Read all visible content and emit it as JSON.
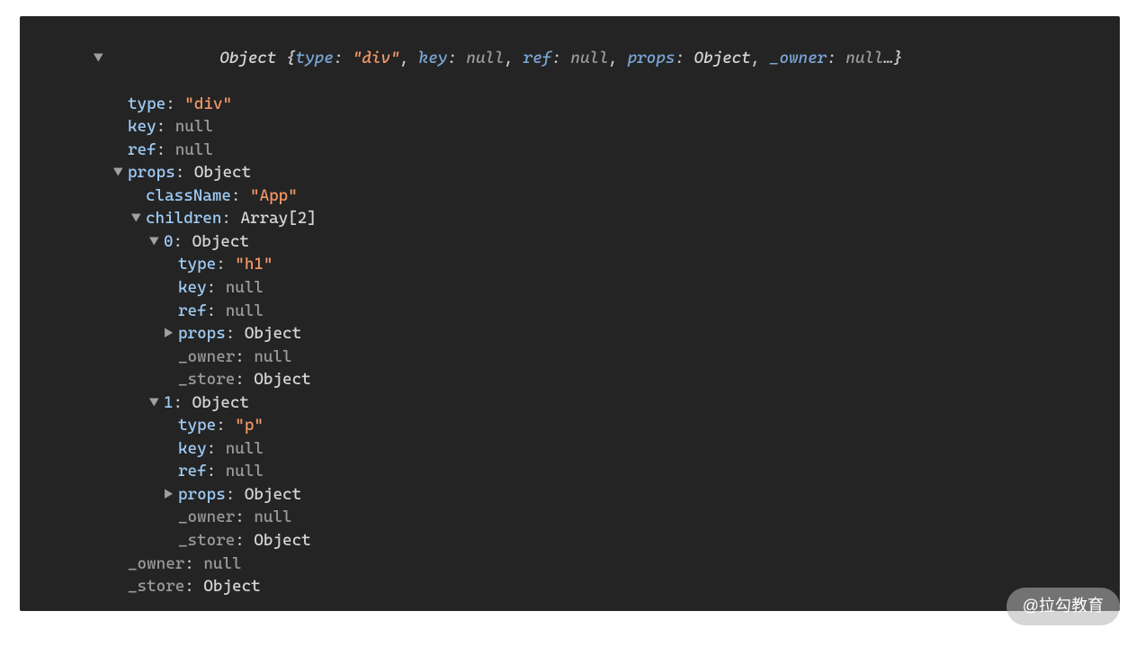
{
  "summary": {
    "prefix": "Object",
    "k1": "type",
    "v1": "\"div\"",
    "k2": "key",
    "v2": "null",
    "k3": "ref",
    "v3": "null",
    "k4": "props",
    "v4": "Object",
    "k5": "_owner",
    "v5": "null",
    "suffix": "…"
  },
  "root": {
    "type": {
      "k": "type",
      "v": "\"div\""
    },
    "key": {
      "k": "key",
      "v": "null"
    },
    "ref": {
      "k": "ref",
      "v": "null"
    },
    "propsLabel": {
      "k": "props",
      "v": "Object"
    },
    "props": {
      "className": {
        "k": "className",
        "v": "\"App\""
      },
      "childrenLabel": {
        "k": "children",
        "v": "Array[2]"
      },
      "children": {
        "i0": {
          "label": {
            "k": "0",
            "v": "Object"
          },
          "type": {
            "k": "type",
            "v": "\"h1\""
          },
          "key": {
            "k": "key",
            "v": "null"
          },
          "ref": {
            "k": "ref",
            "v": "null"
          },
          "props": {
            "k": "props",
            "v": "Object"
          },
          "owner": {
            "k": "_owner",
            "v": "null"
          },
          "store": {
            "k": "_store",
            "v": "Object"
          }
        },
        "i1": {
          "label": {
            "k": "1",
            "v": "Object"
          },
          "type": {
            "k": "type",
            "v": "\"p\""
          },
          "key": {
            "k": "key",
            "v": "null"
          },
          "ref": {
            "k": "ref",
            "v": "null"
          },
          "props": {
            "k": "props",
            "v": "Object"
          },
          "owner": {
            "k": "_owner",
            "v": "null"
          },
          "store": {
            "k": "_store",
            "v": "Object"
          }
        }
      }
    },
    "owner": {
      "k": "_owner",
      "v": "null"
    },
    "store": {
      "k": "_store",
      "v": "Object"
    }
  },
  "watermark": "@拉勾教育"
}
